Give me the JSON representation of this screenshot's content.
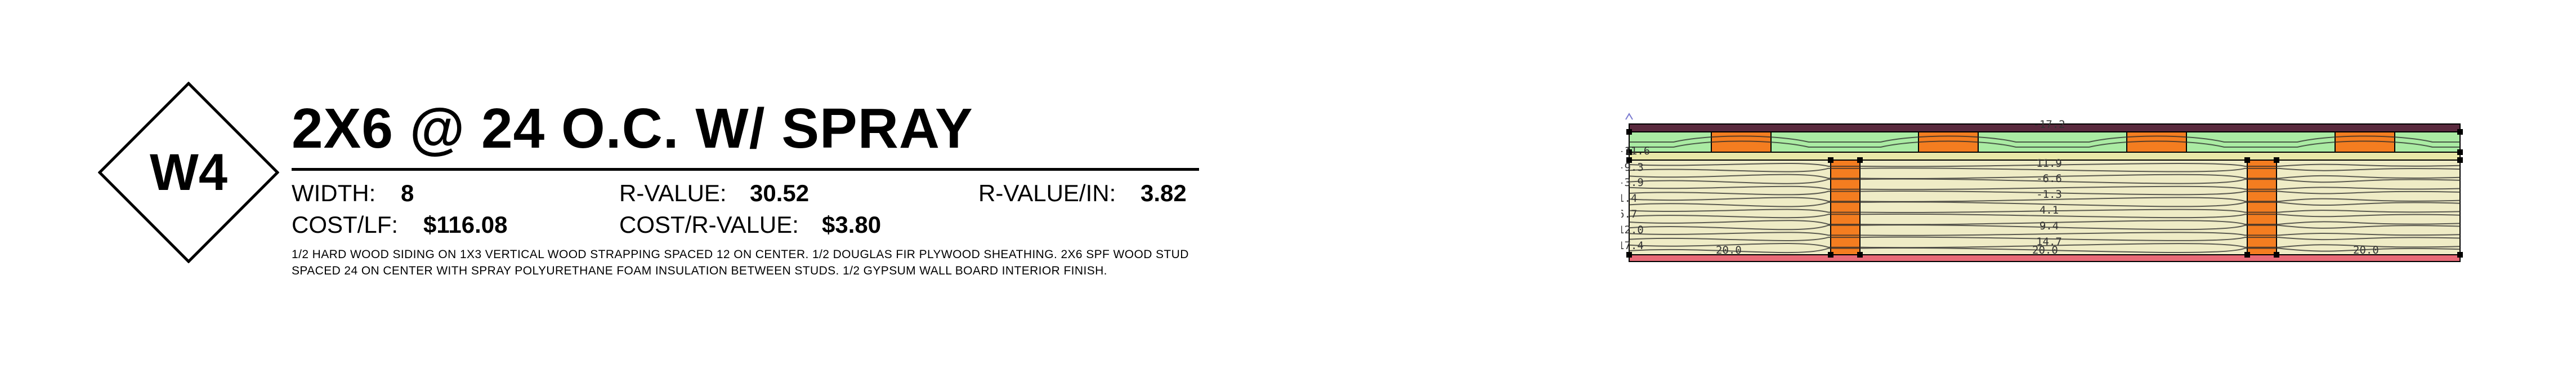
{
  "badge": {
    "code": "W4"
  },
  "assembly": {
    "title": "2X6 @ 24 O.C. W/ SPRAY",
    "stats": {
      "width_label": "WIDTH:",
      "width_value": "8",
      "r_value_label": "R-VALUE:",
      "r_value_value": "30.52",
      "r_per_in_label": "R-VALUE/IN:",
      "r_per_in_value": "3.82",
      "cost_lf_label": "COST/LF:",
      "cost_lf_value": "$116.08",
      "cost_r_label": "COST/R-VALUE:",
      "cost_r_value": "$3.80"
    },
    "description": "1/2 HARD WOOD SIDING ON 1X3 VERTICAL WOOD STRAPPING SPACED 12 ON CENTER. 1/2 DOUGLAS FIR PLYWOOD SHEATHING. 2X6 SPF WOOD STUD SPACED 24 ON CENTER WITH SPRAY POLYURETHANE FOAM INSULATION BETWEEN STUDS. 1/2 GYPSUM WALL BOARD INTERIOR FINISH."
  },
  "section": {
    "isotherm_labels": [
      "-17.2",
      "-11.6",
      "-9.3",
      "-3.9",
      "1.4",
      "6.7",
      "12.0",
      "17.4",
      "11.9",
      "-6.6",
      "-1.3",
      "4.1",
      "9.4",
      "14.7",
      "20.0",
      "20.0",
      "20.0"
    ],
    "colors": {
      "siding": "#5a2a3e",
      "strapping": "#f47d20",
      "air_gap": "#aaeba3",
      "sheathing": "#e9e7a8",
      "insulation": "#efecc6",
      "stud": "#f47d20",
      "gypsum": "#e86a77",
      "isotherm": "#2a2a2a"
    }
  }
}
